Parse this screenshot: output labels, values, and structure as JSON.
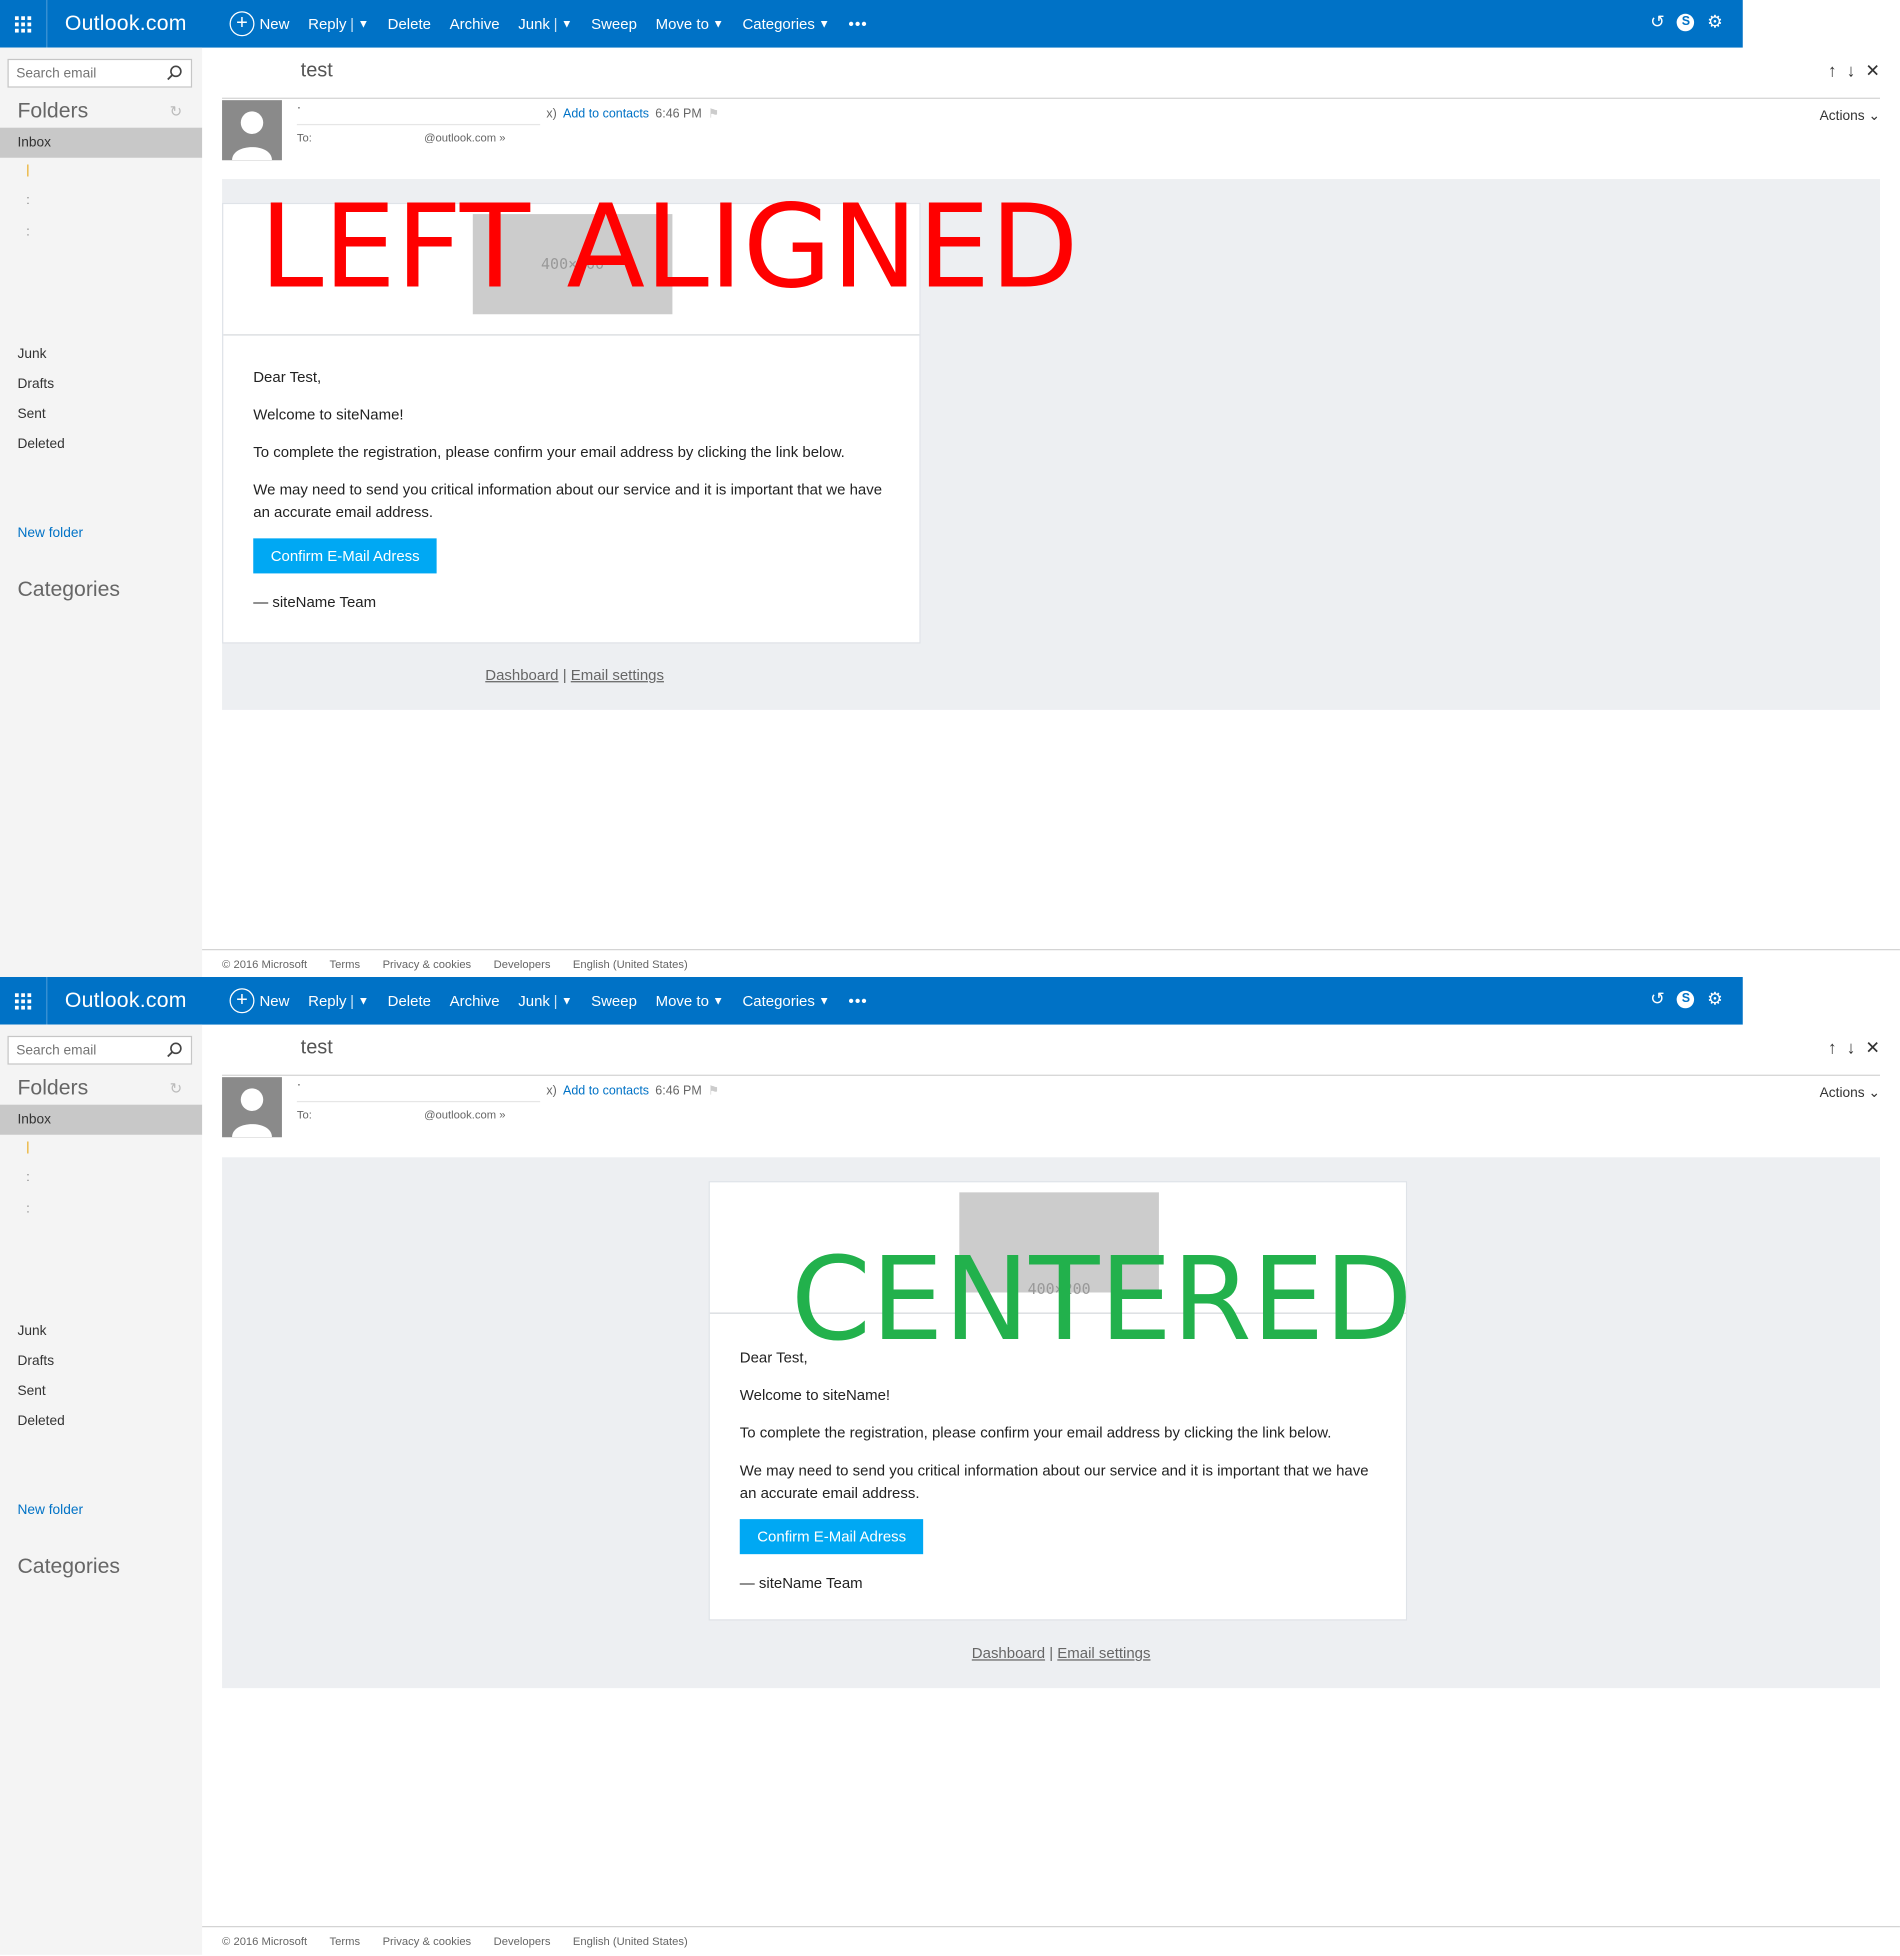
{
  "app": {
    "brand": "Outlook.com"
  },
  "toolbar": {
    "new": "New",
    "reply": "Reply",
    "delete": "Delete",
    "archive": "Archive",
    "junk": "Junk",
    "sweep": "Sweep",
    "move_to": "Move to",
    "categories": "Categories",
    "more": "•••"
  },
  "sidebar": {
    "search_placeholder": "Search email",
    "folders_heading": "Folders",
    "inbox": "Inbox",
    "sub_marks": [
      "|",
      ":",
      ":"
    ],
    "junk": "Junk",
    "drafts": "Drafts",
    "sent": "Sent",
    "deleted": "Deleted",
    "new_folder": "New folder",
    "categories_heading": "Categories"
  },
  "message": {
    "subject": "test",
    "sender": "·",
    "sender_tail": "x)",
    "add_to_contacts": "Add to contacts",
    "time": "6:46 PM",
    "to_label": "To:",
    "to_value": "@outlook.com",
    "actions": "Actions"
  },
  "email": {
    "placeholder": "400×200",
    "greeting": "Dear Test,",
    "welcome": "Welcome to siteName!",
    "line1": "To complete the registration, please confirm your email address by clicking the link below.",
    "line2": "We may need to send you critical information about our service and it is important that we have an accurate email address.",
    "button": "Confirm E-Mail Adress",
    "signoff": "— siteName Team",
    "footer_dashboard": "Dashboard",
    "footer_sep": "|",
    "footer_settings": "Email settings"
  },
  "footer": {
    "copyright": "© 2016 Microsoft",
    "terms": "Terms",
    "privacy": "Privacy & cookies",
    "developers": "Developers",
    "language": "English (United States)"
  },
  "annotations": {
    "top": "LEFT ALIGNED",
    "top_color": "#ff0000",
    "bottom": "CENTERED",
    "bottom_color": "#22b14c"
  },
  "colors": {
    "brand_blue": "#0072c6",
    "button_blue": "#00a8f3"
  }
}
